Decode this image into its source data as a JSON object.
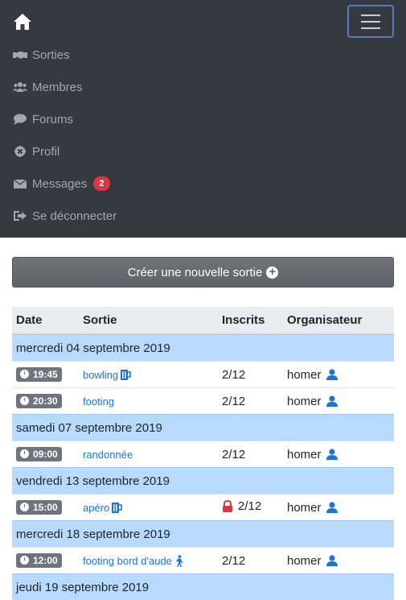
{
  "nav": {
    "items": [
      {
        "label": "Sorties",
        "icon": "handshake-icon"
      },
      {
        "label": "Membres",
        "icon": "users-icon"
      },
      {
        "label": "Forums",
        "icon": "comment-icon"
      },
      {
        "label": "Profil",
        "icon": "gear-icon"
      },
      {
        "label": "Messages",
        "icon": "envelope-icon",
        "badge": "2"
      },
      {
        "label": "Se déconnecter",
        "icon": "sign-out-icon"
      }
    ]
  },
  "create_button": {
    "label": "Créer une nouvelle sortie"
  },
  "table": {
    "headers": [
      "Date",
      "Sortie",
      "Inscrits",
      "Organisateur"
    ],
    "days": [
      {
        "date": "mercredi 04 septembre 2019",
        "events": [
          {
            "time": "19:45",
            "name": "bowling",
            "icon": "beer-icon",
            "inscrits": "2/12",
            "organisateur": "homer"
          },
          {
            "time": "20:30",
            "name": "footing",
            "inscrits": "2/12",
            "organisateur": "homer"
          }
        ]
      },
      {
        "date": "samedi 07 septembre 2019",
        "events": [
          {
            "time": "09:00",
            "name": "randonnée",
            "inscrits": "2/12",
            "organisateur": "homer"
          }
        ]
      },
      {
        "date": "vendredi 13 septembre 2019",
        "events": [
          {
            "time": "15:00",
            "name": "apéro",
            "icon": "beer-icon",
            "locked": true,
            "inscrits": "2/12",
            "organisateur": "homer"
          }
        ]
      },
      {
        "date": "mercredi 18 septembre 2019",
        "events": [
          {
            "time": "12:00",
            "name": "footing bord d'aude",
            "icon": "walking-icon",
            "inscrits": "2/12",
            "organisateur": "homer"
          }
        ]
      },
      {
        "date": "jeudi 19 septembre 2019",
        "events": []
      }
    ]
  },
  "colors": {
    "navbar": "#343a40",
    "day_row": "#b8daff",
    "link": "#1a73d9",
    "badge": "#dc3545",
    "user_icon": "#1a73d9",
    "lock": "#dc3545"
  }
}
